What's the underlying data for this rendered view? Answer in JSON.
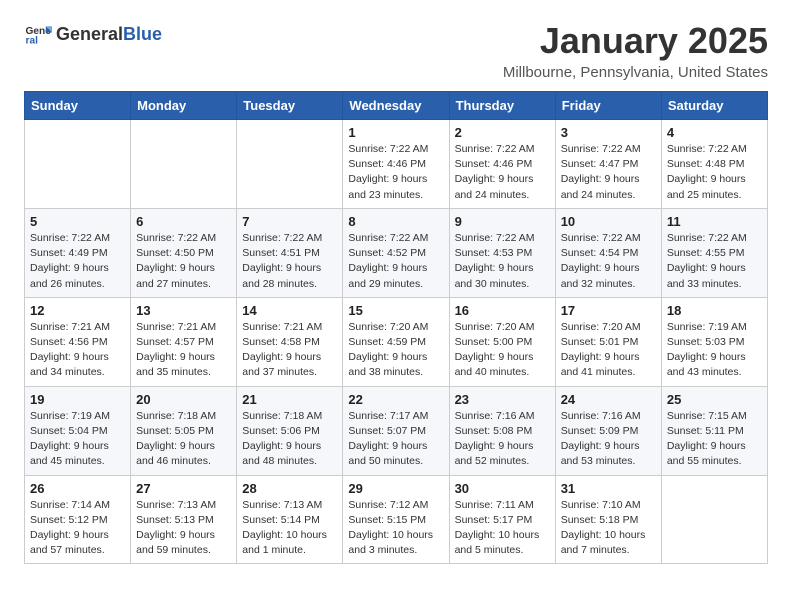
{
  "header": {
    "logo_general": "General",
    "logo_blue": "Blue",
    "month": "January 2025",
    "location": "Millbourne, Pennsylvania, United States"
  },
  "weekdays": [
    "Sunday",
    "Monday",
    "Tuesday",
    "Wednesday",
    "Thursday",
    "Friday",
    "Saturday"
  ],
  "weeks": [
    [
      {
        "day": "",
        "info": ""
      },
      {
        "day": "",
        "info": ""
      },
      {
        "day": "",
        "info": ""
      },
      {
        "day": "1",
        "info": "Sunrise: 7:22 AM\nSunset: 4:46 PM\nDaylight: 9 hours and 23 minutes."
      },
      {
        "day": "2",
        "info": "Sunrise: 7:22 AM\nSunset: 4:46 PM\nDaylight: 9 hours and 24 minutes."
      },
      {
        "day": "3",
        "info": "Sunrise: 7:22 AM\nSunset: 4:47 PM\nDaylight: 9 hours and 24 minutes."
      },
      {
        "day": "4",
        "info": "Sunrise: 7:22 AM\nSunset: 4:48 PM\nDaylight: 9 hours and 25 minutes."
      }
    ],
    [
      {
        "day": "5",
        "info": "Sunrise: 7:22 AM\nSunset: 4:49 PM\nDaylight: 9 hours and 26 minutes."
      },
      {
        "day": "6",
        "info": "Sunrise: 7:22 AM\nSunset: 4:50 PM\nDaylight: 9 hours and 27 minutes."
      },
      {
        "day": "7",
        "info": "Sunrise: 7:22 AM\nSunset: 4:51 PM\nDaylight: 9 hours and 28 minutes."
      },
      {
        "day": "8",
        "info": "Sunrise: 7:22 AM\nSunset: 4:52 PM\nDaylight: 9 hours and 29 minutes."
      },
      {
        "day": "9",
        "info": "Sunrise: 7:22 AM\nSunset: 4:53 PM\nDaylight: 9 hours and 30 minutes."
      },
      {
        "day": "10",
        "info": "Sunrise: 7:22 AM\nSunset: 4:54 PM\nDaylight: 9 hours and 32 minutes."
      },
      {
        "day": "11",
        "info": "Sunrise: 7:22 AM\nSunset: 4:55 PM\nDaylight: 9 hours and 33 minutes."
      }
    ],
    [
      {
        "day": "12",
        "info": "Sunrise: 7:21 AM\nSunset: 4:56 PM\nDaylight: 9 hours and 34 minutes."
      },
      {
        "day": "13",
        "info": "Sunrise: 7:21 AM\nSunset: 4:57 PM\nDaylight: 9 hours and 35 minutes."
      },
      {
        "day": "14",
        "info": "Sunrise: 7:21 AM\nSunset: 4:58 PM\nDaylight: 9 hours and 37 minutes."
      },
      {
        "day": "15",
        "info": "Sunrise: 7:20 AM\nSunset: 4:59 PM\nDaylight: 9 hours and 38 minutes."
      },
      {
        "day": "16",
        "info": "Sunrise: 7:20 AM\nSunset: 5:00 PM\nDaylight: 9 hours and 40 minutes."
      },
      {
        "day": "17",
        "info": "Sunrise: 7:20 AM\nSunset: 5:01 PM\nDaylight: 9 hours and 41 minutes."
      },
      {
        "day": "18",
        "info": "Sunrise: 7:19 AM\nSunset: 5:03 PM\nDaylight: 9 hours and 43 minutes."
      }
    ],
    [
      {
        "day": "19",
        "info": "Sunrise: 7:19 AM\nSunset: 5:04 PM\nDaylight: 9 hours and 45 minutes."
      },
      {
        "day": "20",
        "info": "Sunrise: 7:18 AM\nSunset: 5:05 PM\nDaylight: 9 hours and 46 minutes."
      },
      {
        "day": "21",
        "info": "Sunrise: 7:18 AM\nSunset: 5:06 PM\nDaylight: 9 hours and 48 minutes."
      },
      {
        "day": "22",
        "info": "Sunrise: 7:17 AM\nSunset: 5:07 PM\nDaylight: 9 hours and 50 minutes."
      },
      {
        "day": "23",
        "info": "Sunrise: 7:16 AM\nSunset: 5:08 PM\nDaylight: 9 hours and 52 minutes."
      },
      {
        "day": "24",
        "info": "Sunrise: 7:16 AM\nSunset: 5:09 PM\nDaylight: 9 hours and 53 minutes."
      },
      {
        "day": "25",
        "info": "Sunrise: 7:15 AM\nSunset: 5:11 PM\nDaylight: 9 hours and 55 minutes."
      }
    ],
    [
      {
        "day": "26",
        "info": "Sunrise: 7:14 AM\nSunset: 5:12 PM\nDaylight: 9 hours and 57 minutes."
      },
      {
        "day": "27",
        "info": "Sunrise: 7:13 AM\nSunset: 5:13 PM\nDaylight: 9 hours and 59 minutes."
      },
      {
        "day": "28",
        "info": "Sunrise: 7:13 AM\nSunset: 5:14 PM\nDaylight: 10 hours and 1 minute."
      },
      {
        "day": "29",
        "info": "Sunrise: 7:12 AM\nSunset: 5:15 PM\nDaylight: 10 hours and 3 minutes."
      },
      {
        "day": "30",
        "info": "Sunrise: 7:11 AM\nSunset: 5:17 PM\nDaylight: 10 hours and 5 minutes."
      },
      {
        "day": "31",
        "info": "Sunrise: 7:10 AM\nSunset: 5:18 PM\nDaylight: 10 hours and 7 minutes."
      },
      {
        "day": "",
        "info": ""
      }
    ]
  ]
}
